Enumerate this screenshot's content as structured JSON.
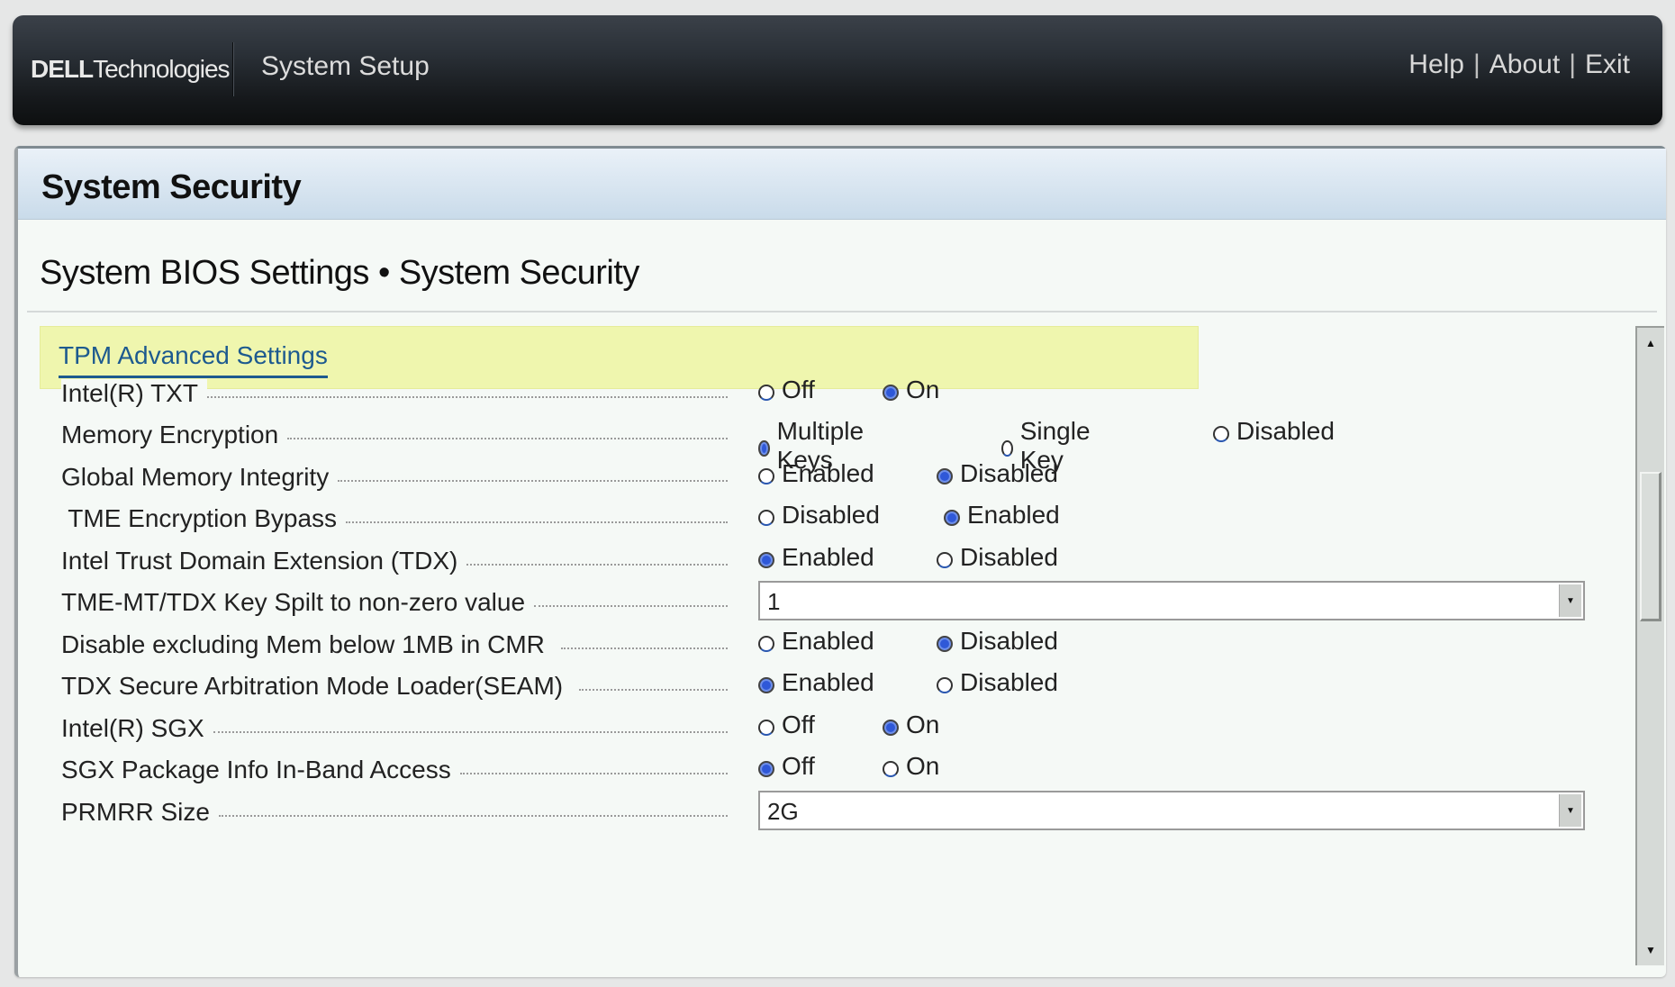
{
  "header": {
    "logo_brand": "DELL",
    "logo_suffix": "Technologies",
    "app_title": "System Setup",
    "links": [
      "Help",
      "About",
      "Exit"
    ],
    "separator": "|"
  },
  "panel": {
    "title": "System Security",
    "breadcrumb": "System BIOS Settings • System Security",
    "section_link": "TPM Advanced Settings"
  },
  "settings": [
    {
      "label": "Intel(R) TXT",
      "type": "radio",
      "options": [
        "Off",
        "On"
      ],
      "selected": "On"
    },
    {
      "label": "Memory Encryption",
      "type": "radio",
      "options": [
        "Multiple Keys",
        "Single Key",
        "Disabled"
      ],
      "selected": "Multiple Keys"
    },
    {
      "label": "Global Memory Integrity",
      "type": "radio",
      "options": [
        "Enabled",
        "Disabled"
      ],
      "selected": "Disabled"
    },
    {
      "label": " TME Encryption Bypass",
      "type": "radio",
      "options": [
        "Disabled",
        "Enabled"
      ],
      "selected": "Enabled"
    },
    {
      "label": "Intel Trust Domain Extension (TDX)",
      "type": "radio",
      "options": [
        "Enabled",
        "Disabled"
      ],
      "selected": "Enabled"
    },
    {
      "label": "TME-MT/TDX Key Spilt to non-zero value",
      "type": "select",
      "value": "1"
    },
    {
      "label": "Disable excluding Mem below 1MB in CMR ",
      "type": "radio",
      "options": [
        "Enabled",
        "Disabled"
      ],
      "selected": "Disabled"
    },
    {
      "label": "TDX Secure Arbitration Mode Loader(SEAM) ",
      "type": "radio",
      "options": [
        "Enabled",
        "Disabled"
      ],
      "selected": "Enabled"
    },
    {
      "label": "Intel(R) SGX",
      "type": "radio",
      "options": [
        "Off",
        "On"
      ],
      "selected": "On"
    },
    {
      "label": "SGX Package Info In-Band Access",
      "type": "radio",
      "options": [
        "Off",
        "On"
      ],
      "selected": "Off"
    },
    {
      "label": "PRMRR Size",
      "type": "select",
      "value": "2G"
    }
  ],
  "colors": {
    "accent_link": "#1d5a8f",
    "section_highlight": "#eff6ae",
    "radio_selected": "#2f58d8"
  }
}
